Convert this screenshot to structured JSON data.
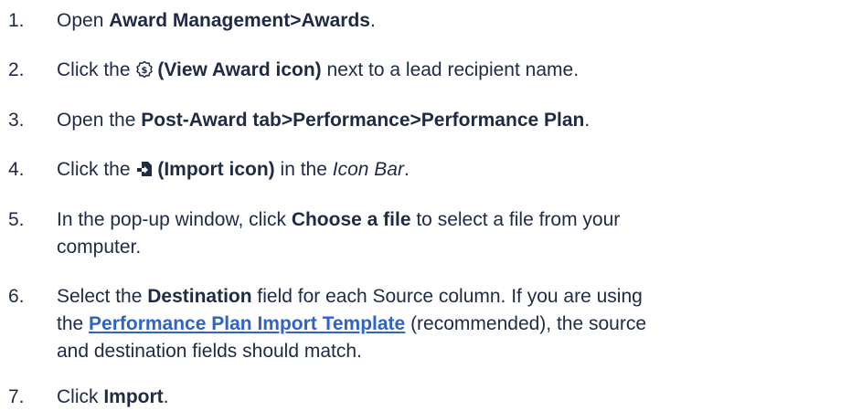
{
  "steps": [
    {
      "num": "1.",
      "pre": "Open ",
      "bold": "Award Management>Awards",
      "post": "."
    },
    {
      "num": "2.",
      "pre": "Click the ",
      "icon": "dollar-badge-icon",
      "bold": "(View Award icon)",
      "post": " next to a lead recipient name."
    },
    {
      "num": "3.",
      "pre": "Open the ",
      "bold": "Post-Award tab>Performance>Performance Plan",
      "post": "."
    },
    {
      "num": "4.",
      "pre": "Click the ",
      "icon": "import-file-icon",
      "bold": "(Import icon)",
      "mid": " in the ",
      "italic": "Icon Bar",
      "post": "."
    },
    {
      "num": "5.",
      "pre": "In the pop-up window, click ",
      "bold": "Choose a file",
      "post_line1": " to select a file from your",
      "line2": "computer."
    },
    {
      "num": "6.",
      "pre": "Select the ",
      "bold": "Destination",
      "post_line1": " field for each Source column. If you are using",
      "line2_pre": "the ",
      "link": "Performance Plan Import Template",
      "line2_post": " (recommended), the source",
      "line3": "and destination fields should match."
    },
    {
      "num": "7.",
      "pre": "Click ",
      "bold": "Import",
      "post": "."
    }
  ]
}
